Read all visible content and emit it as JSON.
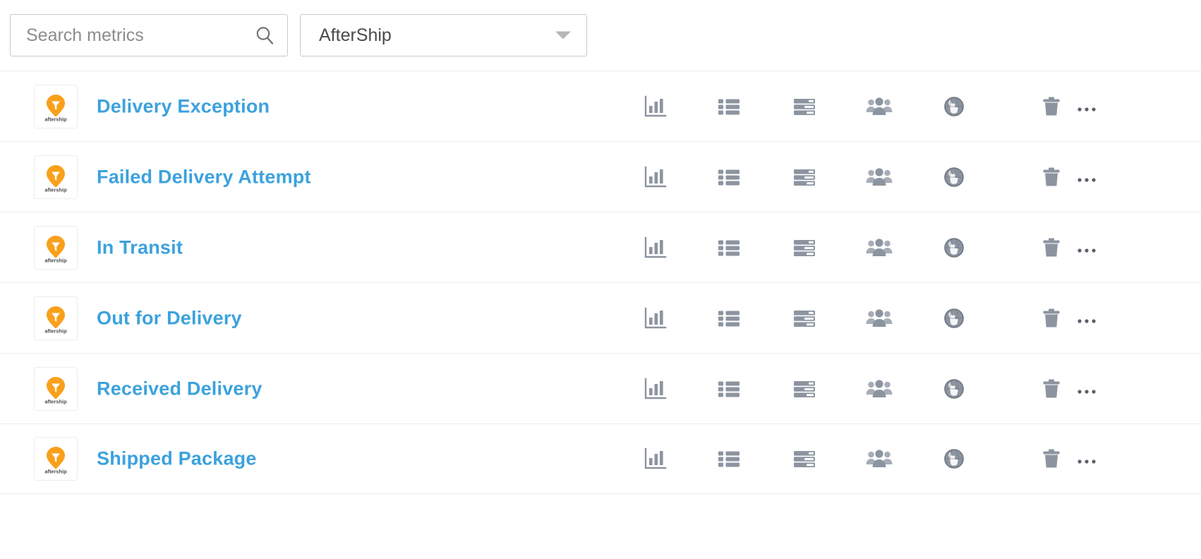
{
  "toolbar": {
    "search": {
      "placeholder": "Search metrics",
      "value": "",
      "icon": "search-icon"
    },
    "integration_select": {
      "selected": "AfterShip",
      "caret_icon": "chevron-down-icon"
    }
  },
  "colors": {
    "link_blue": "#3ca2dd",
    "icon_gray": "#8c94a0",
    "border_gray": "#ececec",
    "input_border": "#c9c9c9",
    "brand_orange": "#f9a01b",
    "text_gray": "#4a4a4a",
    "placeholder_gray": "#8d8d8d"
  },
  "row_actions": [
    {
      "name": "view-chart",
      "icon": "bar-chart-icon"
    },
    {
      "name": "view-list",
      "icon": "list-icon"
    },
    {
      "name": "view-server",
      "icon": "server-rack-icon"
    },
    {
      "name": "view-people",
      "icon": "group-people-icon"
    },
    {
      "name": "view-globe",
      "icon": "globe-icon"
    },
    {
      "name": "delete",
      "icon": "trash-icon"
    },
    {
      "name": "more-options",
      "icon": "ellipsis-icon"
    }
  ],
  "metrics": [
    {
      "logo_alt": "aftership",
      "logo_text": "aftership",
      "name": "Delivery Exception"
    },
    {
      "logo_alt": "aftership",
      "logo_text": "aftership",
      "name": "Failed Delivery Attempt"
    },
    {
      "logo_alt": "aftership",
      "logo_text": "aftership",
      "name": "In Transit"
    },
    {
      "logo_alt": "aftership",
      "logo_text": "aftership",
      "name": "Out for Delivery"
    },
    {
      "logo_alt": "aftership",
      "logo_text": "aftership",
      "name": "Received Delivery"
    },
    {
      "logo_alt": "aftership",
      "logo_text": "aftership",
      "name": "Shipped Package"
    }
  ]
}
